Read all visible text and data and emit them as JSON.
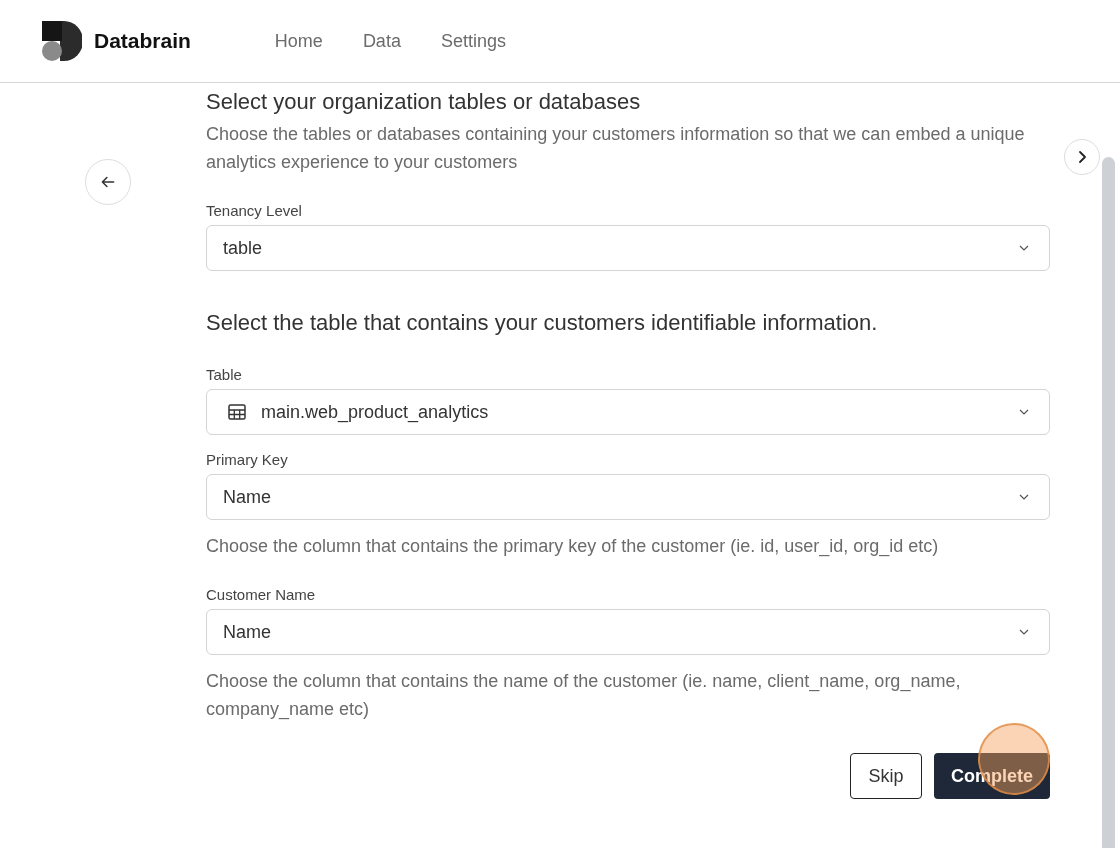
{
  "header": {
    "brand": "Databrain",
    "nav": [
      {
        "label": "Home",
        "selected": false
      },
      {
        "label": "Data",
        "selected": false
      },
      {
        "label": "Settings",
        "selected": false
      }
    ]
  },
  "intro": {
    "title": "Select your organization tables or databases",
    "description": "Choose the tables or databases containing your customers information so that we can embed a unique analytics experience to your customers"
  },
  "tenancy": {
    "label": "Tenancy Level",
    "value": "table"
  },
  "section_title": "Select the table that contains your customers identifiable information.",
  "fields": [
    {
      "label": "Table",
      "value": "main.web_product_analytics",
      "kind": "table"
    },
    {
      "label": "Primary Key",
      "value": "Name",
      "kind": "column",
      "help": "Choose the column that contains the primary key of the customer (ie. id, user_id, org_id etc)"
    },
    {
      "label": "Customer Name",
      "value": "Name",
      "kind": "column",
      "help": "Choose the column that contains the name of the customer (ie. name, client_name, org_name, company_name etc)"
    }
  ],
  "buttons": {
    "skip": "Skip",
    "complete": "Complete"
  }
}
